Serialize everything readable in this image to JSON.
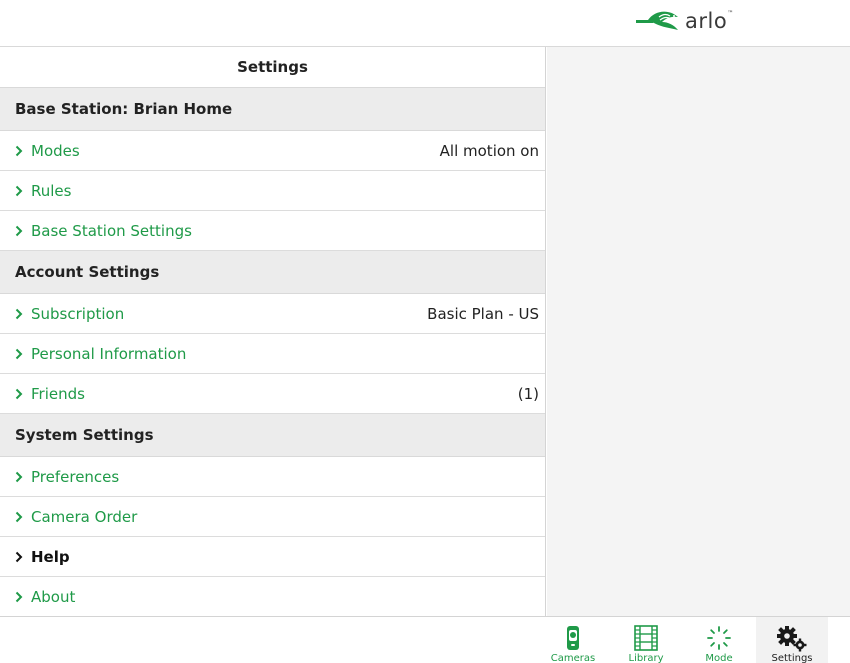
{
  "brand": {
    "logo_text": "arlo",
    "tm": "™",
    "accent": "#1f9a48"
  },
  "panel": {
    "title": "Settings"
  },
  "sections": [
    {
      "header": "Base Station: Brian Home",
      "items": [
        {
          "label": "Modes",
          "value": "All motion on"
        },
        {
          "label": "Rules",
          "value": ""
        },
        {
          "label": "Base Station Settings",
          "value": ""
        }
      ]
    },
    {
      "header": "Account Settings",
      "items": [
        {
          "label": "Subscription",
          "value": "Basic Plan - US"
        },
        {
          "label": "Personal Information",
          "value": ""
        },
        {
          "label": "Friends",
          "value": "(1)"
        }
      ]
    },
    {
      "header": "System Settings",
      "items": [
        {
          "label": "Preferences",
          "value": ""
        },
        {
          "label": "Camera Order",
          "value": ""
        },
        {
          "label": "Help",
          "value": ""
        },
        {
          "label": "About",
          "value": ""
        }
      ]
    }
  ],
  "tabs": [
    {
      "label": "Cameras",
      "icon": "camera-icon"
    },
    {
      "label": "Library",
      "icon": "film-icon"
    },
    {
      "label": "Mode",
      "icon": "mode-spinner-icon"
    },
    {
      "label": "Settings",
      "icon": "gears-icon",
      "active": true
    }
  ]
}
